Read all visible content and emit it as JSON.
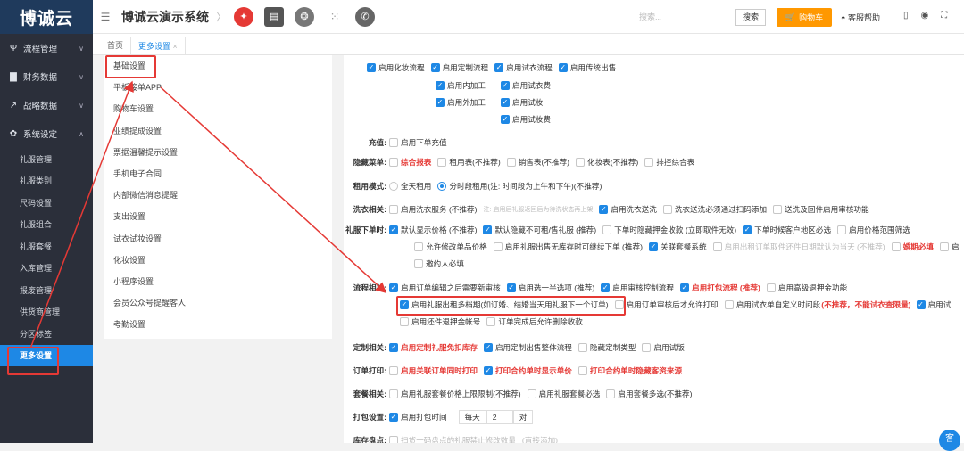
{
  "brand": {
    "logo": "博诚云"
  },
  "sidebar": {
    "groups": [
      {
        "icon": "Ψ",
        "label": "流程管理",
        "chev": "∨"
      },
      {
        "icon": "▇",
        "label": "财务数据",
        "chev": "∨"
      },
      {
        "icon": "↗",
        "label": "战略数据",
        "chev": "∨"
      },
      {
        "icon": "✿",
        "label": "系统设定",
        "chev": "∧"
      }
    ],
    "items": [
      "礼服管理",
      "礼服类别",
      "尺码设置",
      "礼服组合",
      "礼服套餐",
      "入库管理",
      "报废管理",
      "供货商管理",
      "分区标签",
      "更多设置"
    ]
  },
  "topbar": {
    "hamburger": "☰",
    "title": "博诚云演示系统",
    "chevron": "〉",
    "search_placeholder": "搜索...",
    "search_button": "搜索",
    "cart_button": "购物车",
    "help": "客服帮助",
    "right_icons": "▯◉⛶"
  },
  "tabs": {
    "home": "首页",
    "current": "更多设置",
    "close": "×"
  },
  "panel": {
    "items": [
      "基础设置",
      "平板接单APP",
      "购物车设置",
      "业绩提成设置",
      "票据温馨提示设置",
      "手机电子合同",
      "内部微信消息提醒",
      "支出设置",
      "试衣试妆设置",
      "化妆设置",
      "小程序设置",
      "会员公众号提醒客人",
      "考勤设置"
    ]
  },
  "settings": {
    "top": [
      {
        "on": true,
        "text": "启用化妆流程"
      },
      {
        "on": true,
        "text": "启用定制流程"
      },
      {
        "on": true,
        "text": "启用试衣流程"
      },
      {
        "on": true,
        "text": "启用传统出售"
      }
    ],
    "top_col2": [
      {
        "on": true,
        "text": "启用内加工"
      },
      {
        "on": true,
        "text": "启用外加工"
      }
    ],
    "top_col3": [
      {
        "on": true,
        "text": "启用试衣费"
      },
      {
        "on": true,
        "text": "启用试妆"
      },
      {
        "on": true,
        "text": "启用试妆费"
      }
    ],
    "recharge": {
      "label": "充值:",
      "opt": "启用下单充值"
    },
    "hidden_menu": {
      "label": "隐藏菜单:",
      "opts": [
        "综合报表",
        "租用表(不推荐)",
        "销售表(不推荐)",
        "化妆表(不推荐)",
        "排控综合表"
      ]
    },
    "rent_mode": {
      "label": "租用模式:",
      "opts": [
        "全天租用",
        "分时段租用(注: 时间段为上午和下午)(不推荐)"
      ]
    },
    "wash": {
      "label": "洗衣相关:",
      "opts": [
        "启用洗衣服务 (不推荐)",
        "注: 启用后礼服返回后为待洗状态再上架",
        "启用洗衣送洗",
        "洗衣送洗必须通过扫码添加",
        "送洗及回件启用审核功能"
      ]
    },
    "order": {
      "label": "礼服下单时:",
      "row1": [
        "默认显示价格 (不推荐)",
        "默认隐藏不可租/售礼服 (推荐)",
        "下单时隐藏押金收款 (立即取件无效)",
        "下单时候客户地区必选",
        "启用价格范围筛选"
      ],
      "row2": [
        "允许修改单品价格",
        "启用礼服出售无库存时可继续下单 (推荐)",
        "关联套餐系统",
        "启用出租订单取件还件日期默认为当天 (不推荐)",
        "婚期必填",
        "启"
      ],
      "row3": [
        "邀约人必填"
      ]
    },
    "flow": {
      "label": "流程相关:",
      "row1": [
        "启用订单编辑之后需要新审核",
        "启用选一半选项 (推荐)",
        "启用审核控制流程",
        "启用打包流程 (推荐)",
        "启用高级退押金功能"
      ],
      "row2": [
        "启用礼服出租多档期(如订婚、结婚当天用礼服下一个订单)",
        "启用订单审核后才允许打印",
        "启用试衣单自定义时间段",
        "(不推荐，不能试衣查限量)",
        "启用试"
      ],
      "row3": [
        "启用还件退押金帐号",
        "订单完成后允许删除收款"
      ]
    },
    "custom": {
      "label": "定制相关:",
      "opts": [
        "启用定制礼服免扣库存",
        "启用定制出售整体流程",
        "隐藏定制类型",
        "启用试版"
      ]
    },
    "print": {
      "label": "订单打印:",
      "opts": [
        "启用关联订单同时打印",
        "打印合约单时显示单价",
        "打印合约单时隐藏客资来源"
      ]
    },
    "package": {
      "label": "套餐相关:",
      "opts": [
        "启用礼服套餐价格上限限制(不推荐)",
        "启用礼服套餐必选",
        "启用套餐多选(不推荐)"
      ]
    },
    "pack": {
      "label": "打包设置:",
      "opt": "启用打包时间",
      "every": "每天",
      "value": "2",
      "unit": "对"
    },
    "stock": {
      "label": "库存盘点:",
      "opt": "扫货一码盘点的礼服禁止修改数量",
      "hint": "(直接添加)"
    }
  },
  "chat": "客"
}
